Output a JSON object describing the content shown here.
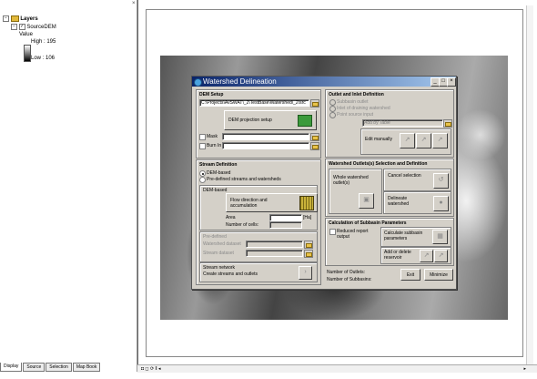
{
  "toc": {
    "close_glyph": "×",
    "layers_label": "Layers",
    "layer_name": "SourceDEM",
    "value_label": "Value",
    "high_label": "High : 195",
    "low_label": "Low : 106",
    "expand_glyph": "−",
    "check_glyph": "✓"
  },
  "tabs": [
    "Display",
    "Source",
    "Selection",
    "Map Book"
  ],
  "statusbar": {
    "controls": "◘ ◻ ⟳ ‖ ◂",
    "scroll_right": "▸"
  },
  "dialog": {
    "title": "Watershed Delineation",
    "minimize_glyph": "_",
    "maximize_glyph": "□",
    "close_glyph": "×",
    "dem_setup": {
      "title": "DEM Setup",
      "dem_path": "C:\\Projects\\AvSWAT\\_2\\TestBase\\Watershed\\_2\\src",
      "projection_button": "DEM projection setup",
      "mask_label": "Mask",
      "burnin_label": "Burn In"
    },
    "stream_definition": {
      "title": "Stream Definition",
      "opt_dem_based": "DEM-based",
      "opt_predefined": "Pre-defined streams and watersheds",
      "subgroup_dem": "DEM-based",
      "flow_dir_label": "Flow direction and accumulation",
      "area_label": "Area",
      "area_unit": "[Ha]",
      "num_cells_label": "Number of cells:",
      "subgroup_predef": "Pre-defined",
      "watershed_dataset": "Watershed dataset",
      "stream_dataset": "Stream dataset",
      "stream_network_label": "Stream network",
      "create_streams_label": "Create streams and outlets"
    },
    "outlet_inlet": {
      "title": "Outlet and Inlet Definition",
      "opt_subbasin": "Subbasin outlet",
      "opt_inlet": "Inlet of draining watershed",
      "opt_point_source": "Point source input",
      "add_by_table": "Add by Table",
      "edit_manually": "Edit manually"
    },
    "outlets_selection": {
      "title": "Watershed Outlets(s) Selection and Definition",
      "whole_watershed": "Whole watershed outlet(s)",
      "cancel_selection": "Cancel selection",
      "delineate_watershed": "Delineate watershed"
    },
    "subbasin_params": {
      "title": "Calculation of Subbasin Parameters",
      "reduced_report": "Reduced report output",
      "calculate_params": "Calculate subbasin parameters",
      "add_delete_reservoir": "Add or delete reservoir"
    },
    "footer": {
      "num_outlets": "Number of Outlets:",
      "num_subbasins": "Number of Subbasins:",
      "exit": "Exit",
      "minimize": "Minimize"
    }
  }
}
